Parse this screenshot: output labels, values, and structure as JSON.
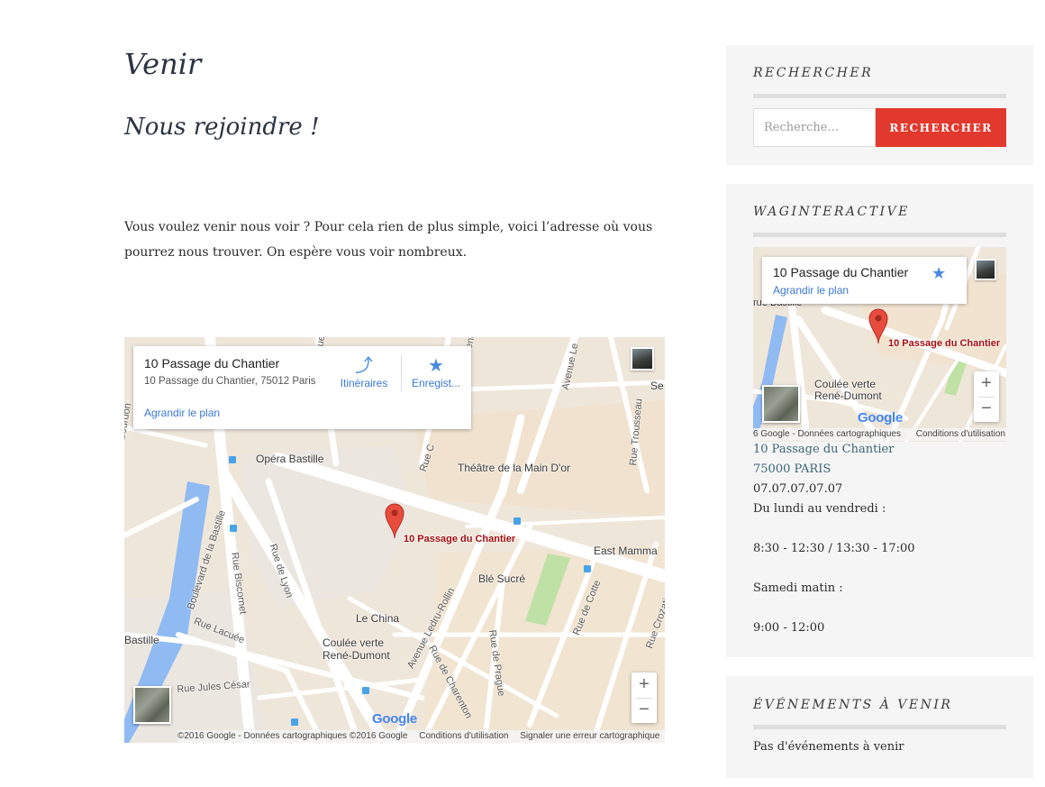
{
  "page": {
    "title": "Venir",
    "subtitle": "Nous rejoindre !",
    "intro": "Vous voulez venir nous voir ? Pour cela rien de plus simple, voici l’adresse où vous pourrez nous trouver. On espère vous voir nombreux."
  },
  "map": {
    "place_name": "10 Passage du Chantier",
    "place_address": "10 Passage du Chantier, 75012 Paris",
    "directions_label": "Itinéraires",
    "save_label": "Enregist...",
    "enlarge_label": "Agrandir le plan",
    "pin_label": "10 Passage du Chantier",
    "zoom_in": "+",
    "zoom_out": "−",
    "google_logo": "Google",
    "attribution": "©2016 Google - Données cartographiques ©2016 Google",
    "terms": "Conditions d'utilisation",
    "report": "Signaler une erreur cartographique",
    "places": {
      "opera": "Opéra Bastille",
      "theatre": "Théâtre de la Main D'or",
      "east_mamma": "East Mamma",
      "ble_sucre": "Blé Sucré",
      "le_china": "Le China",
      "coulee_verte_1": "Coulée verte",
      "coulee_verte_2": "René-Dumont",
      "bastille": "Bastille",
      "se": "Se"
    },
    "roads": {
      "bd_bourdon": "Boulevard Bourdon",
      "bd_bastille": "Boulevard de la Bastille",
      "rue_lyon": "Rue de Lyon",
      "rue_biscornet": "Rue Biscornet",
      "rue_lacuee": "Rue Lacuée",
      "rue_jules_cesar": "Rue Jules César",
      "av_ledru_rollin": "Avenue Ledru-Rollin",
      "rue_charenton": "Rue de Charenton",
      "rue_prague": "Rue de Prague",
      "rue_cotte": "Rue de Cotte",
      "rue_crozatier": "Rue Crozatier",
      "rue_trousseau": "Rue Trousseau",
      "avenue_le": "Avenue Le",
      "avenue_d": "Avenue D",
      "rue_c": "Rue C",
      "rue_n": "Rue d"
    }
  },
  "sidebar": {
    "search": {
      "title": "RECHERCHER",
      "placeholder": "Recherche…",
      "button": "RECHERCHER"
    },
    "contact": {
      "title": "WAGINTERACTIVE",
      "map_place": "10 Passage du Chantier",
      "map_enlarge": "Agrandir le plan",
      "map_pin_label": "10 Passage du Chantier",
      "map_zoom_in": "+",
      "map_zoom_out": "−",
      "map_google_logo": "Google",
      "map_attribution": "6 Google - Données cartographiques",
      "map_terms": "Conditions d'utilisation",
      "map_place_rue": "rue Bastille",
      "map_coulee_1": "Coulée verte",
      "map_coulee_2": "René-Dumont",
      "address_line1": "10 Passage du Chantier",
      "address_line2": "75000 PARIS",
      "phone": "07.07.07.07.07",
      "days": "Du lundi au vendredi :",
      "hours_week": "8:30 - 12:30 / 13:30 - 17:00",
      "saturday": "Samedi matin :",
      "hours_sat": "9:00 - 12:00"
    },
    "events": {
      "title": "ÉVÉNEMENTS À VENIR",
      "empty": "Pas d'événements à venir"
    }
  },
  "colors": {
    "accent": "#e2392f",
    "link": "#3a6475",
    "map_link": "#3a78d8",
    "sidebar_bg": "#f5f5f5"
  }
}
